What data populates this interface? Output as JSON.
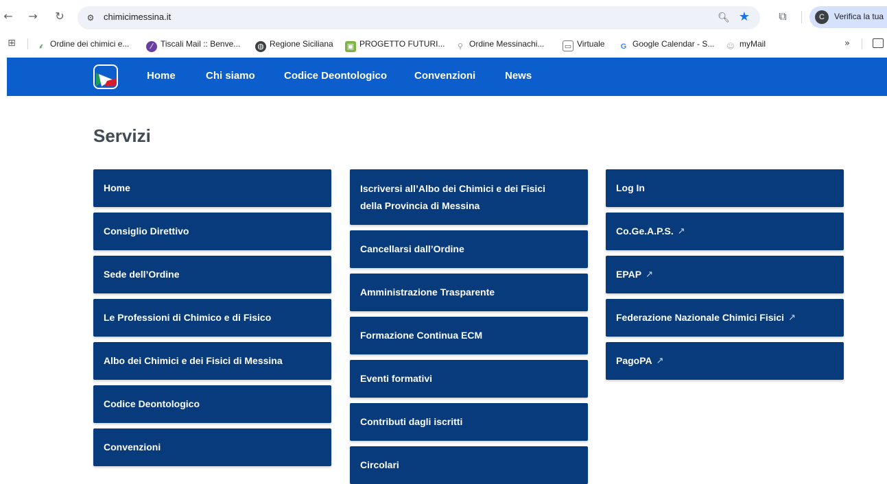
{
  "browser": {
    "url": "chimicimessina.it",
    "profile_text": "Verifica la tua",
    "bookmarks": [
      {
        "label": "Ordine dei chimici e...",
        "icon": "plant-icon"
      },
      {
        "label": "Tiscali Mail :: Benve...",
        "icon": "tiscali-icon"
      },
      {
        "label": "Regione Siciliana",
        "icon": "globe-icon"
      },
      {
        "label": "PROGETTO FUTURI...",
        "icon": "image-icon"
      },
      {
        "label": "Ordine Messinachi...",
        "icon": "link-icon"
      },
      {
        "label": "Virtuale",
        "icon": "page-icon"
      },
      {
        "label": "Google Calendar - S...",
        "icon": "google-icon"
      },
      {
        "label": "myMail",
        "icon": "mymail-icon"
      }
    ]
  },
  "header": {
    "nav": [
      "Home",
      "Chi siamo",
      "Codice Deontologico",
      "Convenzioni",
      "News"
    ]
  },
  "servizi": {
    "title": "Servizi",
    "col1": [
      "Home",
      "Consiglio Direttivo",
      "Sede dell’Ordine",
      "Le Professioni di Chimico e di Fisico",
      "Albo dei Chimici e dei Fisici di Messina",
      "Codice Deontologico",
      "Convenzioni"
    ],
    "col2": [
      "Iscriversi all’Albo dei Chimici e dei Fisici della Provincia di Messina",
      "Cancellarsi dall’Ordine",
      "Amministrazione Trasparente",
      "Formazione Continua ECM",
      "Eventi formativi",
      "Contributi dagli iscritti",
      "Circolari"
    ],
    "col3": [
      "Log In",
      "Co.Ge.A.P.S.",
      "EPAP",
      "Federazione Nazionale Chimici Fisici",
      "PagoPA"
    ]
  },
  "colors": {
    "header_blue": "#0b5ecb",
    "tile_blue": "#073b7c",
    "title_gray": "#404b55"
  }
}
